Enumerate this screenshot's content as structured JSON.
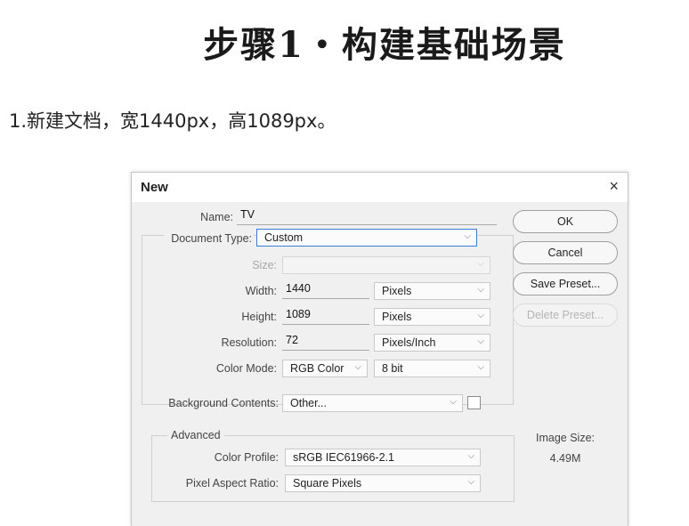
{
  "heading": "步骤1・构建基础场景",
  "intro": "1.新建文档，宽1440px，高1089px。",
  "dialog": {
    "title": "New",
    "close_icon": "×",
    "name_label": "Name:",
    "name_value": "TV",
    "document_type_label": "Document Type:",
    "document_type_value": "Custom",
    "size_label": "Size:",
    "size_value": "",
    "width_label": "Width:",
    "width_value": "1440",
    "width_unit": "Pixels",
    "height_label": "Height:",
    "height_value": "1089",
    "height_unit": "Pixels",
    "resolution_label": "Resolution:",
    "resolution_value": "72",
    "resolution_unit": "Pixels/Inch",
    "color_mode_label": "Color Mode:",
    "color_mode_value": "RGB Color",
    "bit_depth_value": "8 bit",
    "background_label": "Background Contents:",
    "background_value": "Other...",
    "advanced_title": "Advanced",
    "color_profile_label": "Color Profile:",
    "color_profile_value": "sRGB IEC61966-2.1",
    "pixel_aspect_label": "Pixel Aspect Ratio:",
    "pixel_aspect_value": "Square Pixels",
    "ok_label": "OK",
    "cancel_label": "Cancel",
    "save_preset_label": "Save Preset...",
    "delete_preset_label": "Delete Preset...",
    "image_size_label": "Image Size:",
    "image_size_value": "4.49M",
    "chevron_icon": "⌵"
  }
}
